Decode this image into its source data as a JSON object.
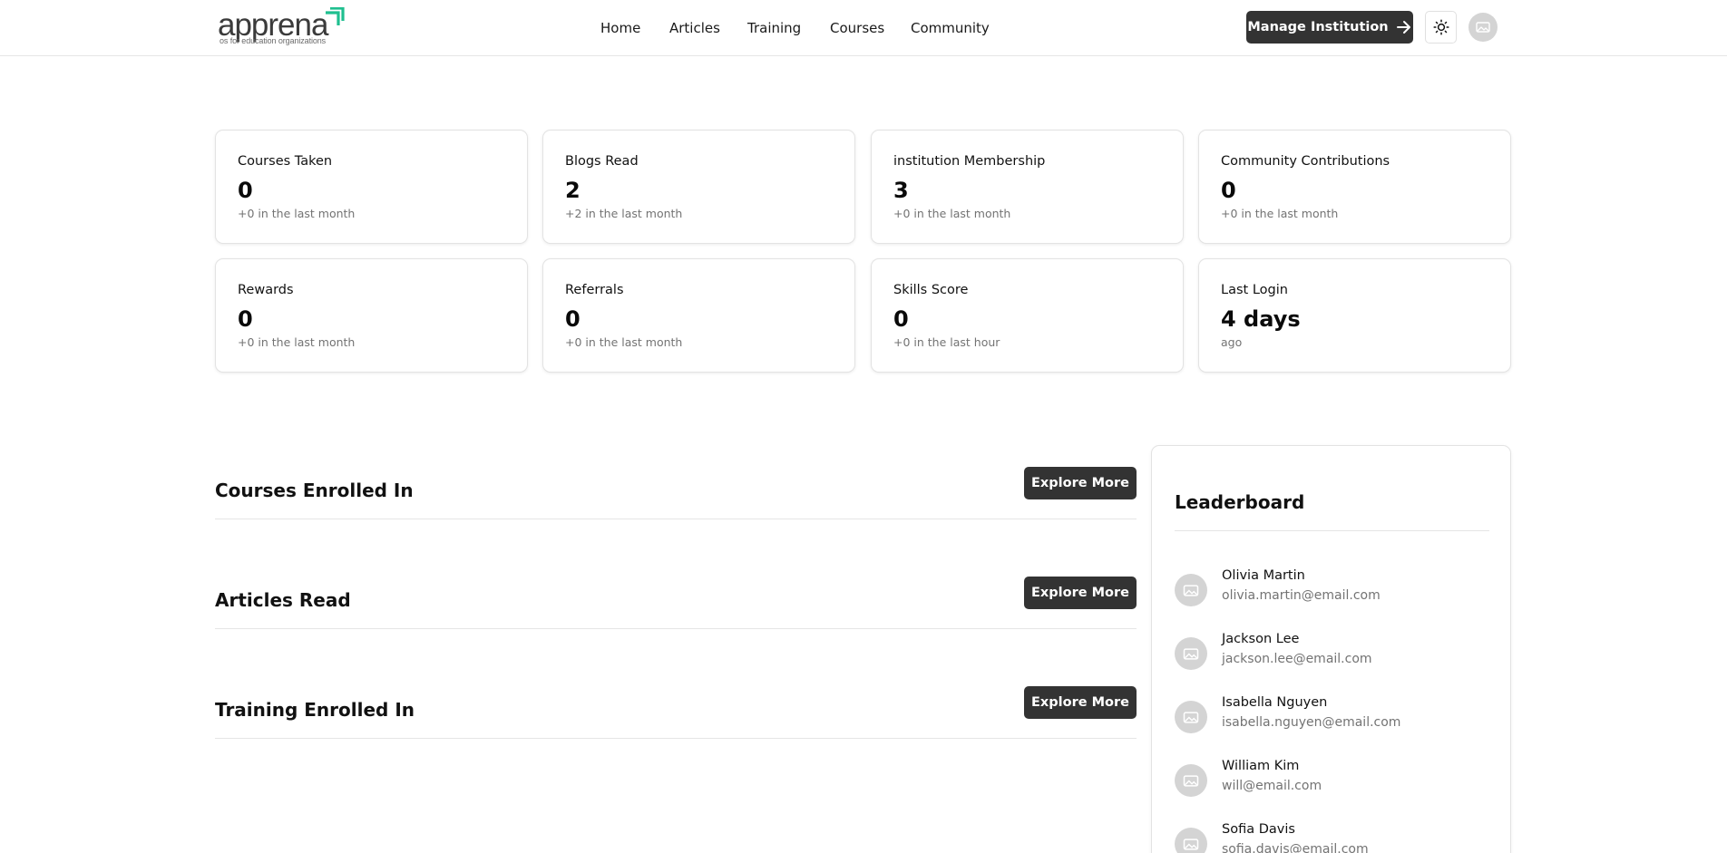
{
  "brand": {
    "name": "apprena",
    "tagline": "os for education organizations",
    "accent_color": "#1fbf8f"
  },
  "nav": {
    "links": [
      "Home",
      "Articles",
      "Training",
      "Courses",
      "Community"
    ]
  },
  "header": {
    "manage_label": "Manage Institution",
    "manage_icon": "arrow-right-icon",
    "theme_icon": "sun-icon",
    "avatar_icon": "image-placeholder-icon"
  },
  "stats": [
    {
      "title": "Courses Taken",
      "value": "0",
      "sub": "+0 in the last month"
    },
    {
      "title": "Blogs Read",
      "value": "2",
      "sub": "+2 in the last month"
    },
    {
      "title": "institution Membership",
      "value": "3",
      "sub": "+0 in the last month"
    },
    {
      "title": "Community Contributions",
      "value": "0",
      "sub": "+0 in the last month"
    },
    {
      "title": "Rewards",
      "value": "0",
      "sub": "+0 in the last month"
    },
    {
      "title": "Referrals",
      "value": "0",
      "sub": "+0 in the last month"
    },
    {
      "title": "Skills Score",
      "value": "0",
      "sub": "+0 in the last hour"
    },
    {
      "title": "Last Login",
      "value": "4 days",
      "sub": "ago"
    }
  ],
  "sections": [
    {
      "title": "Courses Enrolled In",
      "button": "Explore More"
    },
    {
      "title": "Articles Read",
      "button": "Explore More"
    },
    {
      "title": "Training Enrolled In",
      "button": "Explore More"
    }
  ],
  "leaderboard": {
    "title": "Leaderboard",
    "entries": [
      {
        "name": "Olivia Martin",
        "email": "olivia.martin@email.com"
      },
      {
        "name": "Jackson Lee",
        "email": "jackson.lee@email.com"
      },
      {
        "name": "Isabella Nguyen",
        "email": "isabella.nguyen@email.com"
      },
      {
        "name": "William Kim",
        "email": "will@email.com"
      },
      {
        "name": "Sofia Davis",
        "email": "sofia.davis@email.com"
      }
    ]
  }
}
